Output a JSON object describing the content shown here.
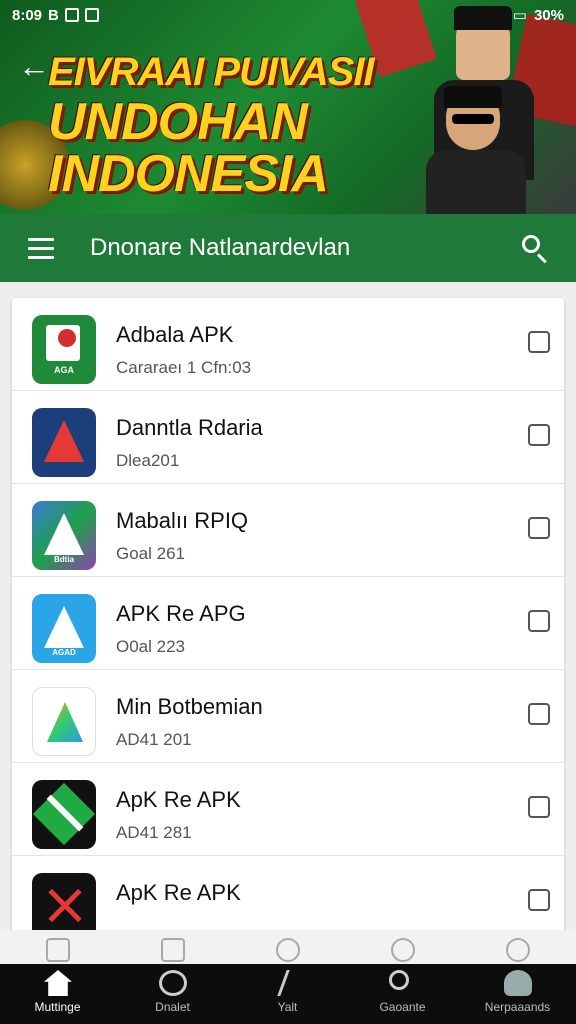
{
  "status_bar": {
    "time": "8:09",
    "indicators_left": "B",
    "indicators_right": "30%"
  },
  "banner": {
    "headline_line1": "EIVRAAI PUIVASII",
    "headline_line2": "UNDOHAN INDONESIA"
  },
  "appbar": {
    "title": "Dnonare Natlanardevlan"
  },
  "apps": [
    {
      "name": "Adbala APK",
      "subtitle": "Cararaeı 1 Cfn:03",
      "checked": false,
      "icon": "app-icon-p-green",
      "icon_caption": "AGA"
    },
    {
      "name": "Danntla Rdaria",
      "subtitle": "Dlea201",
      "checked": false,
      "icon": "app-icon-a-navy",
      "icon_caption": ""
    },
    {
      "name": "Mabalıı RPIQ",
      "subtitle": "Goal 261",
      "checked": false,
      "icon": "app-icon-a-gradient",
      "icon_caption": "Bdtia"
    },
    {
      "name": "APK Re APG",
      "subtitle": "O0al 223",
      "checked": false,
      "icon": "app-icon-a-blue",
      "icon_caption": "AGAD"
    },
    {
      "name": "Min Botbemian",
      "subtitle": "AD41 201",
      "checked": false,
      "icon": "app-icon-a-color",
      "icon_caption": ""
    },
    {
      "name": "ApK Re APK",
      "subtitle": "AD41 281",
      "checked": false,
      "icon": "app-icon-x-green",
      "icon_caption": ""
    },
    {
      "name": "ApK Re APK",
      "subtitle": "",
      "checked": false,
      "icon": "app-icon-x-red",
      "icon_caption": ""
    }
  ],
  "bottom_nav": [
    {
      "label": "Muttinge",
      "icon": "home-icon",
      "active": true
    },
    {
      "label": "Dnalet",
      "icon": "explore-icon",
      "active": false
    },
    {
      "label": "Yalt",
      "icon": "edit-icon",
      "active": false
    },
    {
      "label": "Gaoante",
      "icon": "search-icon",
      "active": false
    },
    {
      "label": "Nerpaaands",
      "icon": "profile-icon",
      "active": false
    }
  ],
  "colors": {
    "appbar": "#1f7a3a",
    "banner": "#1d8a32",
    "headline": "#ffd21f",
    "nav_bg": "#0d0d0d"
  }
}
